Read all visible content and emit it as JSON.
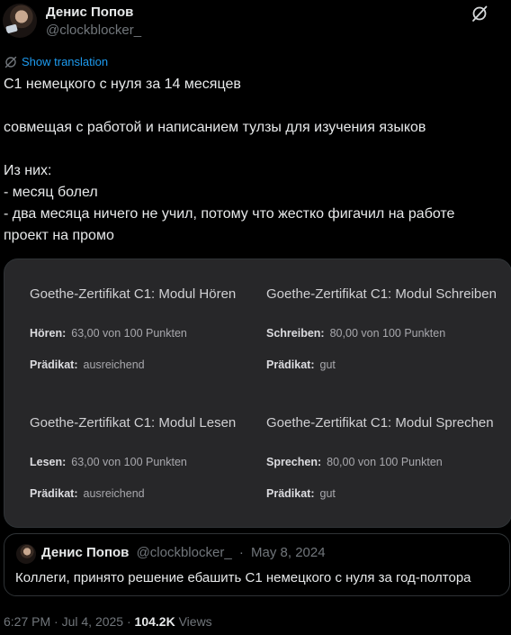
{
  "author": {
    "name": "Денис Попов",
    "handle": "@clockblocker_"
  },
  "translate": {
    "label": "Show translation"
  },
  "tweet": {
    "lines": [
      "C1 немецкого с нуля за 14 месяцев",
      "",
      "совмещая с работой и написанием тулзы для изучения языков",
      "",
      "Из них:",
      "- месяц болел",
      "- два месяца ничего не учил, потому что жестко фигачил на работе",
      "проект на промо"
    ]
  },
  "media": {
    "modules": [
      {
        "title": "Goethe-Zertifikat C1: Modul Hören",
        "score_label": "Hören:",
        "score_value": "63,00 von 100 Punkten",
        "grade_label": "Prädikat:",
        "grade_value": "ausreichend"
      },
      {
        "title": "Goethe-Zertifikat C1: Modul Schreiben",
        "score_label": "Schreiben:",
        "score_value": "80,00 von 100 Punkten",
        "grade_label": "Prädikat:",
        "grade_value": "gut"
      },
      {
        "title": "Goethe-Zertifikat C1: Modul Lesen",
        "score_label": "Lesen:",
        "score_value": "63,00 von 100 Punkten",
        "grade_label": "Prädikat:",
        "grade_value": "ausreichend"
      },
      {
        "title": "Goethe-Zertifikat C1: Modul Sprechen",
        "score_label": "Sprechen:",
        "score_value": "80,00 von 100 Punkten",
        "grade_label": "Prädikat:",
        "grade_value": "gut"
      }
    ]
  },
  "quote": {
    "name": "Денис Попов",
    "handle": "@clockblocker_",
    "sep": "·",
    "date": "May 8, 2024",
    "text": "Коллеги, принято решение ебашить C1 немецкого с нуля за год-полтора"
  },
  "meta": {
    "time": "6:27 PM",
    "sep1": "·",
    "date": "Jul 4, 2025",
    "sep2": "·",
    "views_count": "104.2K",
    "views_label": "Views"
  },
  "icons": {
    "grok": "grok-slash-icon",
    "translate": "translate-icon"
  }
}
